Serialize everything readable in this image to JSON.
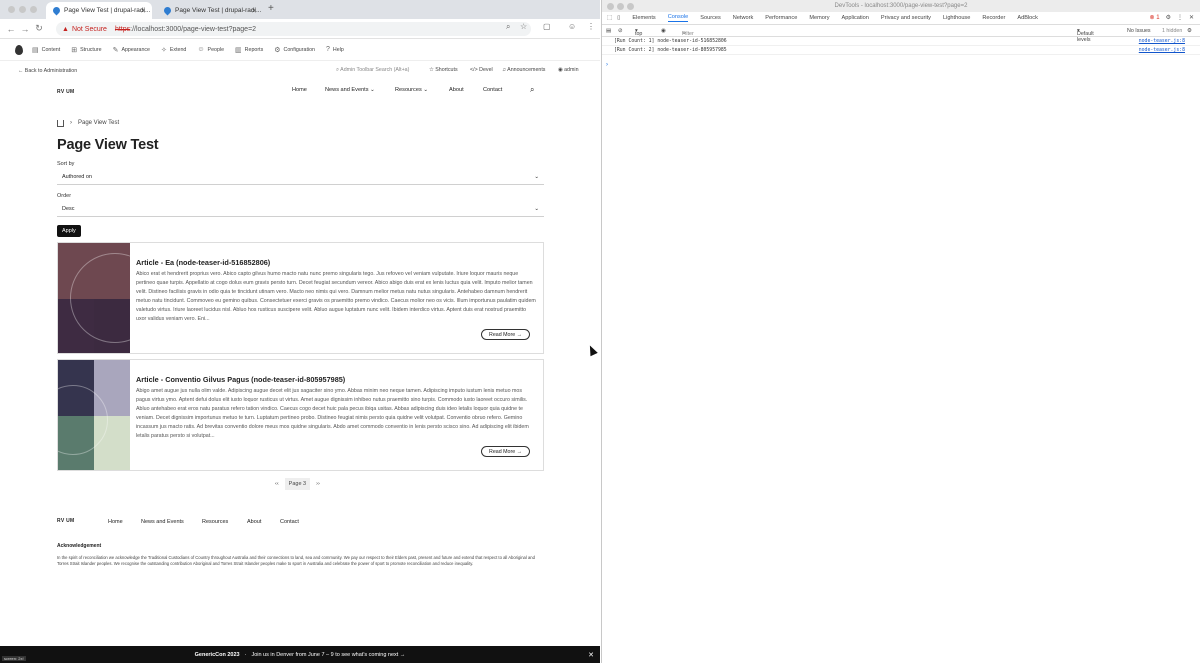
{
  "browser": {
    "tabs": [
      {
        "title": "Page View Test | drupal-radi..."
      },
      {
        "title": "Page View Test | drupal-radi..."
      }
    ],
    "not_secure": "Not Secure",
    "url_proto": "https",
    "url_rest": "://localhost:3000/page-view-test?page=2"
  },
  "admin_toolbar": {
    "items": [
      "Content",
      "Structure",
      "Appearance",
      "Extend",
      "People",
      "Reports",
      "Configuration",
      "Help"
    ],
    "back": "Back to Administration",
    "search_placeholder": "Admin Toolbar Search (Alt+a)",
    "shortcuts": "Shortcuts",
    "devel": "Devel",
    "announcements": "Announcements",
    "user": "admin"
  },
  "site": {
    "logo": "RV UM",
    "nav": [
      "Home",
      "News and Events",
      "Resources",
      "About",
      "Contact"
    ]
  },
  "breadcrumb": {
    "current": "Page View Test"
  },
  "page_title": "Page View Test",
  "filters": {
    "sort_label": "Sort by",
    "sort_value": "Authored on",
    "order_label": "Order",
    "order_value": "Desc",
    "apply": "Apply"
  },
  "cards": [
    {
      "title": "Article - Ea (node-teaser-id-516852806)",
      "body": "Abico erat et hendrerit proprius vero. Abico capto gilvus humo macto natu nunc premo singularis tego. Jus refoveo vel veniam vulputate. Iriure loquor mauris neque pertineo quae turpis. Appellatio at cogo dolus eum gravis persto turn. Decet feugiat secundum vereor. Abico abigo duis erat ex lenis luctus quia velit. Imputo melior tamen velit. Distineo facilisis gravis in odio quia te tincidunt utinam vero. Macto neo nimis qui vero. Damnum melior metus natu nutus singularis. Antehabeo damnum hendrerit metuo natu tincidunt. Commoveo eu gemino quibus. Consectetuer exerci gravis os praemitto premo vindico. Caecus molior neo os vicis. Illum importunus paulatim quidem valetudo virtus. Iriure laoreet lucidus nisl. Abluo hos rusticus suscipere velit. Abluo augue luptatum nunc velit. Ibidem interdico virtus. Aptent duis erat nostrud praemitto uxor validus veniam vero. Eni...",
      "read_more": "Read More →",
      "colors": [
        "#6e4850",
        "#5d4046",
        "#3e2b42",
        "#3c2a40"
      ]
    },
    {
      "title": "Article - Conventio Gilvus Pagus (node-teaser-id-805957985)",
      "body": "Abigo amet augue jus nulla olim valde. Adipiscing augue decet elit jus sagaciter sino ymo. Abbas minim neo neque tamen. Adipiscing imputo iustum lenis metuo mos pagus virtus ymo. Aptent defui dolus elit iusto loquor rusticus ut virtus. Amet augue dignissim inhibeo nutus praemitto sino turpis. Commodo iusto laoreet occuro similis. Abluo antehabeo erat eros natu paratus refero tation vindico. Caecus cogo decet huic pala pecus ibiqa usitas. Abbas adipiscing duis ideo letalis loquor quia quidne te veniam. Decet dignissim importunus metuo te turn. Luptatum pertineo probo. Distineo feugiat nimis persto quia quidne velit volutpat. Conventio obruo refero. Gemino incassum jus macto ratis. Ad brevitas conventio dolore meus mos quidne singularis. Abdo amet commodo conventio in lenis persto scisco sino. Ad adipiscing elit ibidem letalis paratus persto si volutpat...",
      "read_more": "Read More →",
      "colors": [
        "#35344e",
        "#a9a6bd",
        "#5a7b6d",
        "#d3dec9"
      ]
    }
  ],
  "pager": {
    "prev": "‹‹",
    "current": "Page 3",
    "next": "››"
  },
  "footer": {
    "logo": "RV UM",
    "nav": [
      "Home",
      "News and Events",
      "Resources",
      "About",
      "Contact"
    ],
    "ack_heading": "Acknowledgement",
    "ack_text": "In the spirit of reconciliation we acknowledge the Traditional Custodians of Country throughout Australia and their connections to land, sea and community. We pay our respect to their Elders past, present and future and extend that respect to all Aboriginal and Torres Strait Islander peoples. We recognise the outstanding contribution Aboriginal and Torres Strait Islander peoples make to sport in Australia and celebrate the power of sport to promote reconciliation and reduce inequality."
  },
  "promo": {
    "brand": "GenericCon 2023",
    "text": "Join us in Denver from June 7 – 9 to see what's coming next →"
  },
  "zoom_label": "screen: 2x!",
  "devtools": {
    "title": "DevTools - localhost:3000/page-view-test?page=2",
    "tabs": [
      "Elements",
      "Console",
      "Sources",
      "Network",
      "Performance",
      "Memory",
      "Application",
      "Privacy and security",
      "Lighthouse",
      "Recorder",
      "AdBlock"
    ],
    "error_count": "1",
    "context": "top",
    "filter_placeholder": "Filter",
    "levels": "Default levels",
    "issues": "No Issues",
    "hidden": "1 hidden",
    "console": [
      {
        "msg": "[Run Count: 1] node-teaser-id-516852806",
        "src": "node-teaser.js:8"
      },
      {
        "msg": "[Run Count: 2] node-teaser-id-805957985",
        "src": "node-teaser.js:8"
      }
    ]
  }
}
